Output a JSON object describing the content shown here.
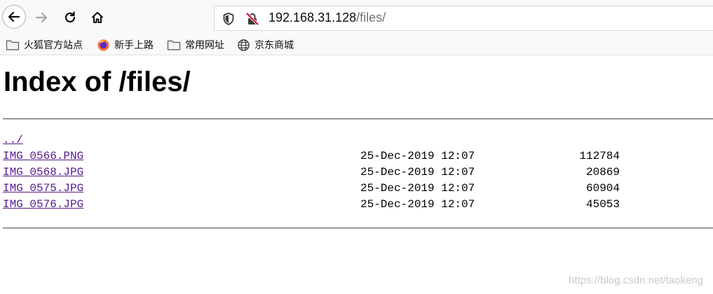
{
  "browser": {
    "url_host": "192.168.31.128",
    "url_path": "/files/",
    "icons": {
      "back": "back-arrow-icon",
      "forward": "forward-arrow-icon",
      "reload": "reload-icon",
      "home": "home-icon",
      "tracking": "shield-icon",
      "insecure": "insecure-lock-icon"
    }
  },
  "bookmarks": [
    {
      "label": "火狐官方站点",
      "icon": "folder-icon"
    },
    {
      "label": "新手上路",
      "icon": "firefox-icon"
    },
    {
      "label": "常用网址",
      "icon": "folder-icon"
    },
    {
      "label": "京东商城",
      "icon": "globe-icon"
    }
  ],
  "page": {
    "title": "Index of /files/",
    "parent_link": "../",
    "files": [
      {
        "name": "IMG_0566.PNG",
        "date": "25-Dec-2019 12:07",
        "size": "112784"
      },
      {
        "name": "IMG_0568.JPG",
        "date": "25-Dec-2019 12:07",
        "size": "20869"
      },
      {
        "name": "IMG_0575.JPG",
        "date": "25-Dec-2019 12:07",
        "size": "60904"
      },
      {
        "name": "IMG_0576.JPG",
        "date": "25-Dec-2019 12:07",
        "size": "45053"
      }
    ]
  },
  "watermark": "https://blog.csdn.net/taokeng",
  "colors": {
    "visited_link": "#551a8b",
    "toolbar_bg": "#f9f9fa",
    "insecure_red": "#d70022"
  }
}
